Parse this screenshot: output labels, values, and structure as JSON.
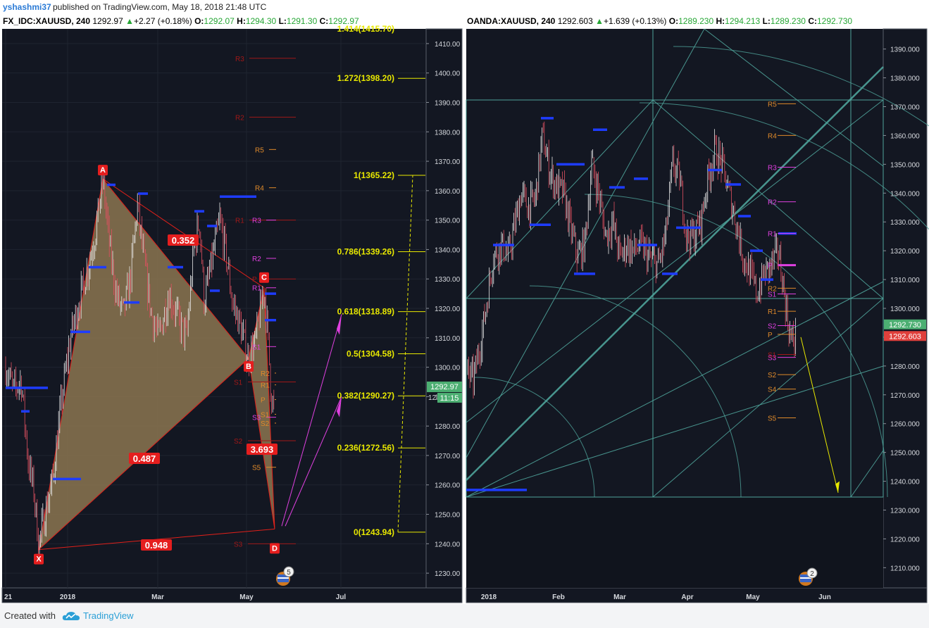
{
  "publisher": {
    "user": "yshashmi37",
    "text": "published on TradingView.com, May 18, 2018 21:48 UTC"
  },
  "footer": {
    "created_with": "Created with",
    "brand": "TradingView"
  },
  "colors": {
    "background": "#131722",
    "candle_up": "#e8e8e8",
    "candle_down": "#e05060",
    "harmonic_fill": "#8c7650",
    "harmonic_line": "#e0201a",
    "fib_line": "#e8e800",
    "pivot": "#e08a2a",
    "pivot_magenta": "#e040e0",
    "gann_line": "#4fa39a",
    "price_tag_green": "#4caf72",
    "price_tag_red": "#e0403c"
  },
  "left_chart": {
    "symbol": "FX_IDC:XAUUSD, 240",
    "last": "1292.97",
    "change": "+2.27 (+0.18%)",
    "o_label": "O:",
    "o": "1292.07",
    "h_label": "H:",
    "h": "1294.30",
    "l_label": "L:",
    "l": "1291.30",
    "c_label": "C:",
    "c": "1292.97",
    "price_tag": "1292.97",
    "time_tag": "11:15",
    "price_tag_partial": "12",
    "event_badge": "5"
  },
  "right_chart": {
    "symbol": "OANDA:XAUUSD, 240",
    "last": "1292.603",
    "change": "+1.639 (+0.13%)",
    "o_label": "O:",
    "o": "1289.230",
    "h_label": "H:",
    "h": "1294.213",
    "l_label": "L:",
    "l": "1289.230",
    "c_label": "C:",
    "c": "1292.730",
    "price_tag_1": "1292.730",
    "price_tag_2": "1292.603",
    "event_badge": "2"
  },
  "chart_data": [
    {
      "type": "line",
      "title": "FX_IDC:XAUUSD, 240",
      "ylim": [
        1225,
        1415
      ],
      "y_ticks": [
        "1410.00",
        "1400.00",
        "1390.00",
        "1380.00",
        "1370.00",
        "1360.00",
        "1350.00",
        "1340.00",
        "1330.00",
        "1320.00",
        "1310.00",
        "1300.00",
        "1290.00",
        "1280.00",
        "1270.00",
        "1260.00",
        "1250.00",
        "1240.00",
        "1230.00"
      ],
      "x_ticks": [
        "21",
        "2018",
        "Mar",
        "May",
        "Jul"
      ],
      "harmonic_pattern": {
        "points": [
          {
            "label": "X",
            "price": 1238
          },
          {
            "label": "A",
            "price": 1364
          },
          {
            "label": "B",
            "price": 1303
          },
          {
            "label": "C",
            "price": 1327
          },
          {
            "label": "D",
            "price": 1245
          }
        ],
        "ratios": [
          "0.352",
          "0.487",
          "3.693",
          "0.948"
        ]
      },
      "fibonacci_levels": [
        {
          "label": "1.414(1415.70)",
          "price": 1415.7
        },
        {
          "label": "1.272(1398.20)",
          "price": 1398.2
        },
        {
          "label": "1(1365.22)",
          "price": 1365.22
        },
        {
          "label": "0.786(1339.26)",
          "price": 1339.26
        },
        {
          "label": "0.618(1318.89)",
          "price": 1318.89
        },
        {
          "label": "0.5(1304.58)",
          "price": 1304.58
        },
        {
          "label": "0.382(1290.27)",
          "price": 1290.27
        },
        {
          "label": "0.236(1272.56)",
          "price": 1272.56
        },
        {
          "label": "0(1243.94)",
          "price": 1243.94
        }
      ],
      "pivots": [
        {
          "label": "R3",
          "price": 1405,
          "color": "dark"
        },
        {
          "label": "R2",
          "price": 1385,
          "color": "dark"
        },
        {
          "label": "R5",
          "price": 1374,
          "color": "orange"
        },
        {
          "label": "R4",
          "price": 1361,
          "color": "orange"
        },
        {
          "label": "R1",
          "price": 1350,
          "color": "dark"
        },
        {
          "label": "R3",
          "price": 1350,
          "color": "magenta"
        },
        {
          "label": "R2",
          "price": 1337,
          "color": "magenta"
        },
        {
          "label": "P",
          "price": 1330,
          "color": "dark"
        },
        {
          "label": "R1",
          "price": 1327,
          "color": "magenta"
        },
        {
          "label": "S1",
          "price": 1307,
          "color": "magenta"
        },
        {
          "label": "R2",
          "price": 1298,
          "color": "orange"
        },
        {
          "label": "S1",
          "price": 1295,
          "color": "dark"
        },
        {
          "label": "R1",
          "price": 1294,
          "color": "orange"
        },
        {
          "label": "P",
          "price": 1289,
          "color": "orange"
        },
        {
          "label": "S3",
          "price": 1283,
          "color": "magenta"
        },
        {
          "label": "S1",
          "price": 1284,
          "color": "orange"
        },
        {
          "label": "S2",
          "price": 1281,
          "color": "orange"
        },
        {
          "label": "S2",
          "price": 1275,
          "color": "dark"
        },
        {
          "label": "S5",
          "price": 1266,
          "color": "orange"
        },
        {
          "label": "S3",
          "price": 1240,
          "color": "dark"
        }
      ],
      "close": 1292.97
    },
    {
      "type": "line",
      "title": "OANDA:XAUUSD, 240",
      "ylim": [
        1203,
        1397
      ],
      "y_ticks": [
        "1390.000",
        "1380.000",
        "1370.000",
        "1360.000",
        "1350.000",
        "1340.000",
        "1330.000",
        "1320.000",
        "1310.000",
        "1300.000",
        "1290.000",
        "1280.000",
        "1270.000",
        "1260.000",
        "1250.000",
        "1240.000",
        "1230.000",
        "1220.000",
        "1210.000"
      ],
      "x_ticks": [
        "2018",
        "Feb",
        "Mar",
        "Apr",
        "May",
        "Jun"
      ],
      "pivots": [
        {
          "label": "R5",
          "price": 1371,
          "color": "orange"
        },
        {
          "label": "R4",
          "price": 1360,
          "color": "orange"
        },
        {
          "label": "R3",
          "price": 1349,
          "color": "magenta"
        },
        {
          "label": "R2",
          "price": 1337,
          "color": "magenta"
        },
        {
          "label": "R1",
          "price": 1326,
          "color": "magenta"
        },
        {
          "label": "P",
          "price": 1315,
          "color": "magenta"
        },
        {
          "label": "R2",
          "price": 1307,
          "color": "orange"
        },
        {
          "label": "S1",
          "price": 1305,
          "color": "magenta"
        },
        {
          "label": "R1",
          "price": 1299,
          "color": "orange"
        },
        {
          "label": "S2",
          "price": 1294,
          "color": "magenta"
        },
        {
          "label": "P",
          "price": 1291,
          "color": "orange"
        },
        {
          "label": "S3",
          "price": 1283,
          "color": "magenta"
        },
        {
          "label": "S1",
          "price": 1284,
          "color": "dark"
        },
        {
          "label": "S2",
          "price": 1277,
          "color": "orange"
        },
        {
          "label": "S4",
          "price": 1272,
          "color": "orange"
        },
        {
          "label": "S5",
          "price": 1262,
          "color": "orange"
        }
      ],
      "close": 1292.73
    }
  ]
}
